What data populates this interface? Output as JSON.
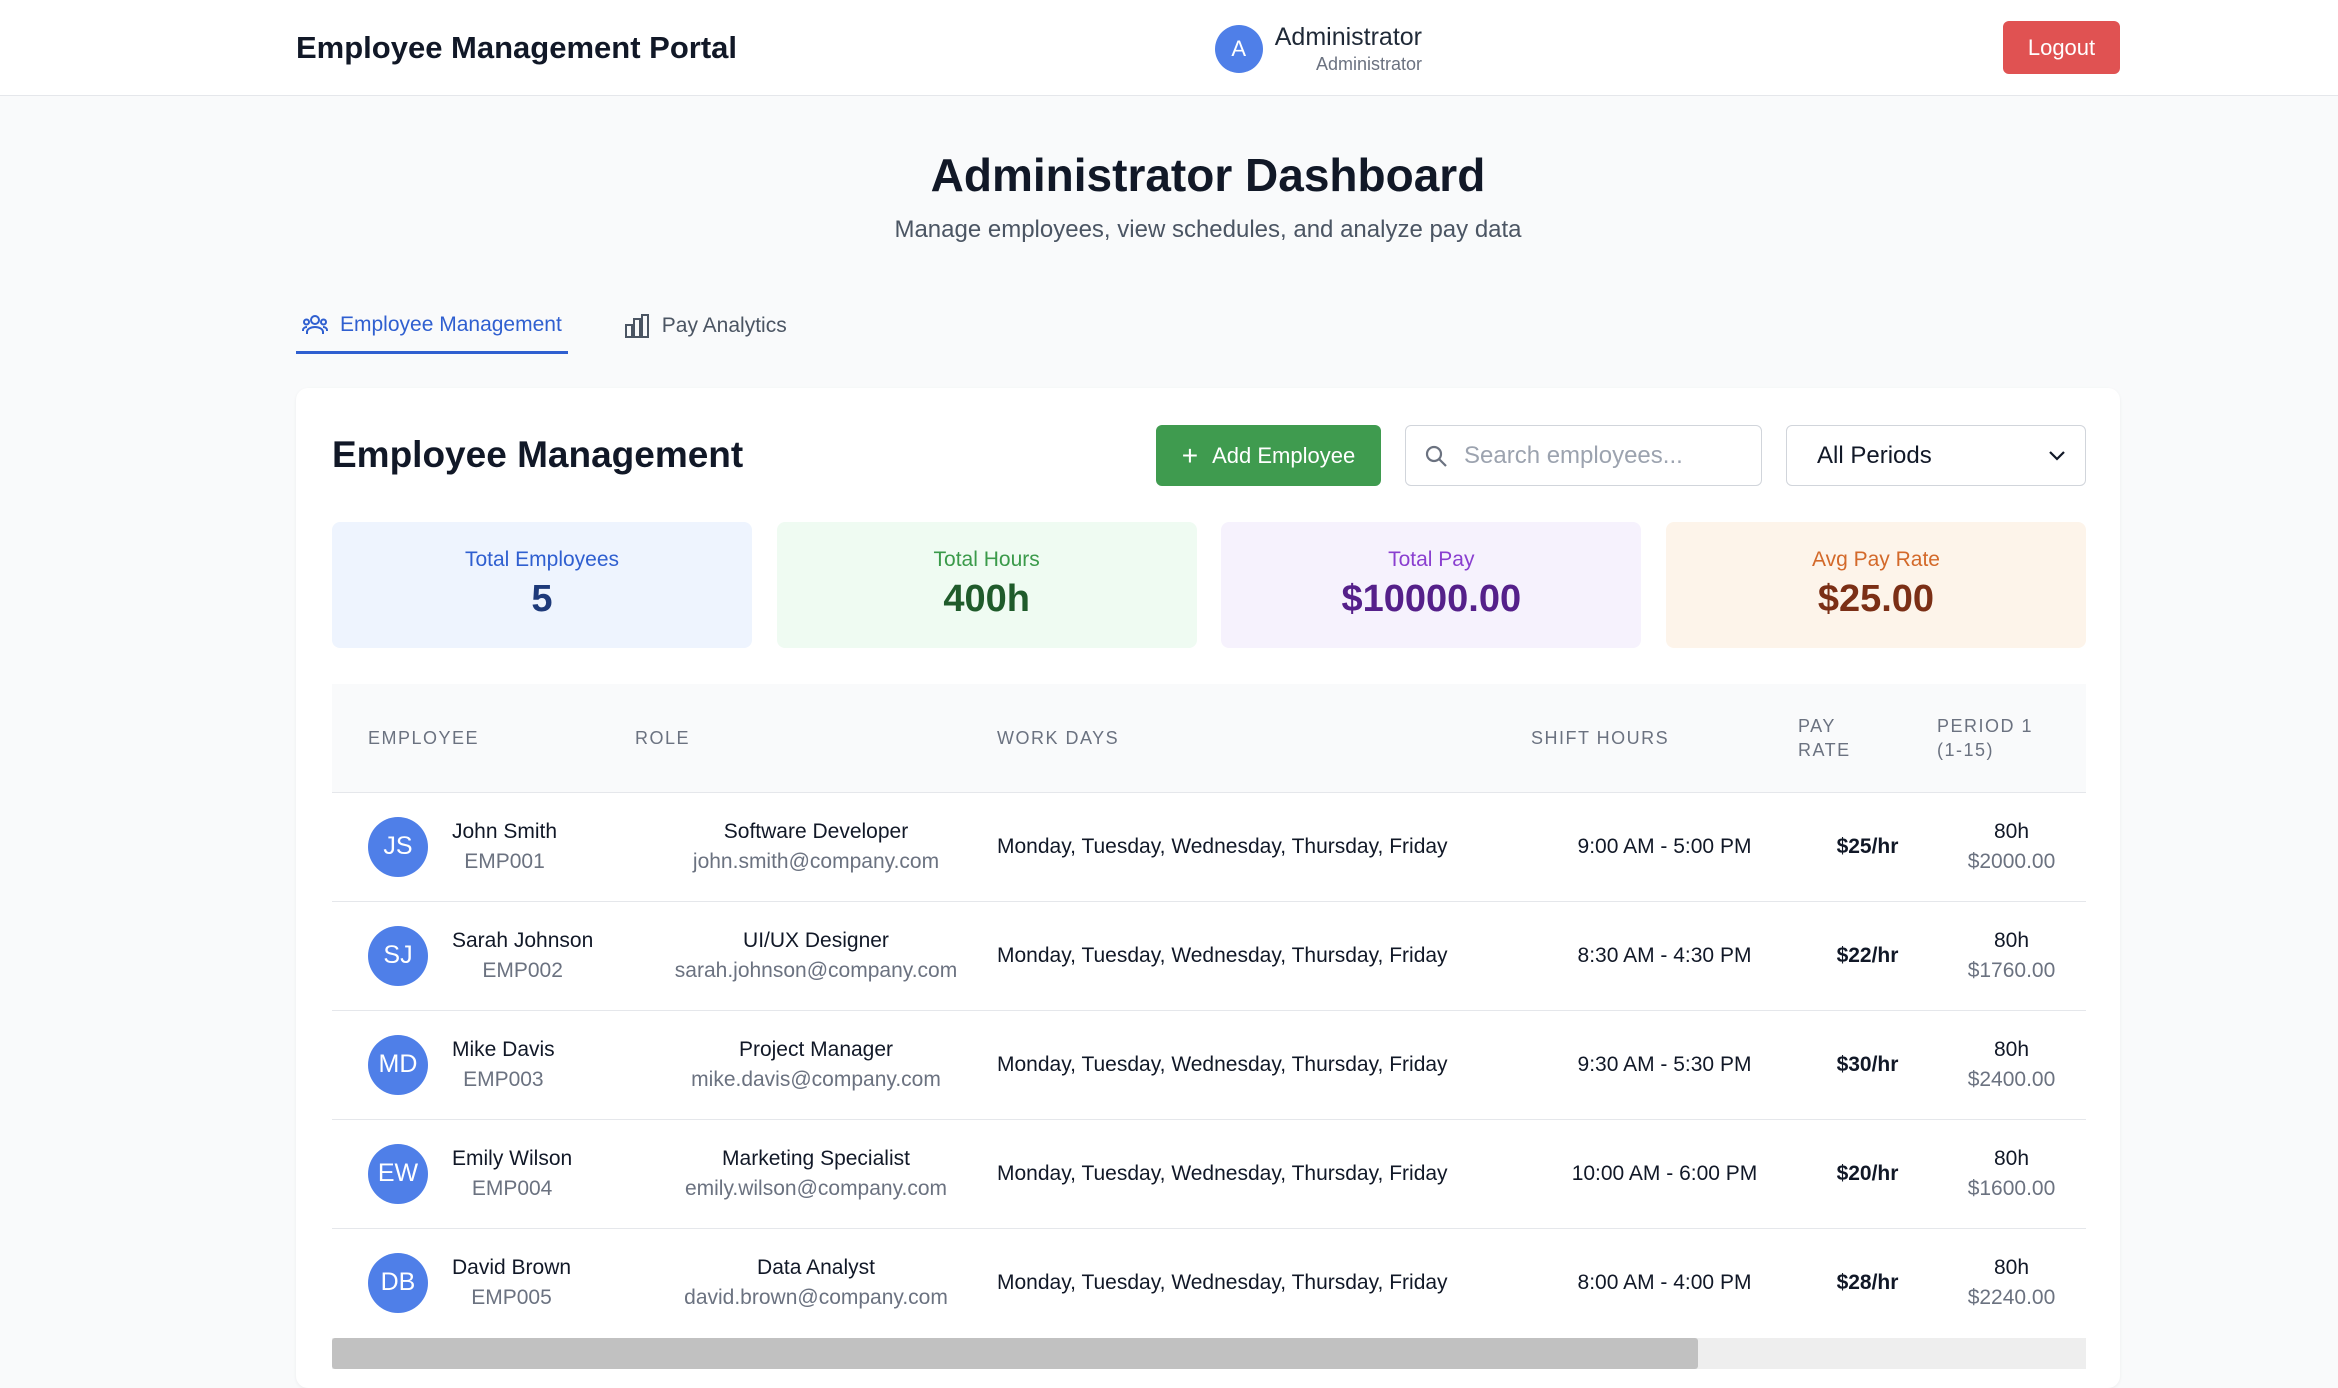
{
  "header": {
    "title": "Employee Management Portal",
    "user_initial": "A",
    "user_name": "Administrator",
    "user_role": "Administrator",
    "logout_label": "Logout"
  },
  "hero": {
    "title": "Administrator Dashboard",
    "subtitle": "Manage employees, view schedules, and analyze pay data"
  },
  "tabs": [
    {
      "label": "Employee Management",
      "icon": "users-icon",
      "active": true
    },
    {
      "label": "Pay Analytics",
      "icon": "bar-chart-icon",
      "active": false
    }
  ],
  "panel": {
    "title": "Employee Management",
    "add_label": "Add Employee",
    "search_placeholder": "Search employees...",
    "period_selected": "All Periods"
  },
  "stats": [
    {
      "label": "Total Employees",
      "value": "5"
    },
    {
      "label": "Total Hours",
      "value": "400h"
    },
    {
      "label": "Total Pay",
      "value": "$10000.00"
    },
    {
      "label": "Avg Pay Rate",
      "value": "$25.00"
    }
  ],
  "table": {
    "headers": {
      "employee": "Employee",
      "role": "Role",
      "work_days": "Work Days",
      "shift_hours": "Shift Hours",
      "pay_rate_1": "Pay",
      "pay_rate_2": "Rate",
      "period_1": "Period 1",
      "period_2": "(1-15)"
    },
    "rows": [
      {
        "initials": "JS",
        "name": "John Smith",
        "id": "EMP001",
        "role": "Software Developer",
        "email": "john.smith@company.com",
        "days": "Monday, Tuesday, Wednesday, Thursday, Friday",
        "shift": "9:00 AM - 5:00 PM",
        "rate": "$25/hr",
        "hours": "80h",
        "pay": "$2000.00"
      },
      {
        "initials": "SJ",
        "name": "Sarah Johnson",
        "id": "EMP002",
        "role": "UI/UX Designer",
        "email": "sarah.johnson@company.com",
        "days": "Monday, Tuesday, Wednesday, Thursday, Friday",
        "shift": "8:30 AM - 4:30 PM",
        "rate": "$22/hr",
        "hours": "80h",
        "pay": "$1760.00"
      },
      {
        "initials": "MD",
        "name": "Mike Davis",
        "id": "EMP003",
        "role": "Project Manager",
        "email": "mike.davis@company.com",
        "days": "Monday, Tuesday, Wednesday, Thursday, Friday",
        "shift": "9:30 AM - 5:30 PM",
        "rate": "$30/hr",
        "hours": "80h",
        "pay": "$2400.00"
      },
      {
        "initials": "EW",
        "name": "Emily Wilson",
        "id": "EMP004",
        "role": "Marketing Specialist",
        "email": "emily.wilson@company.com",
        "days": "Monday, Tuesday, Wednesday, Thursday, Friday",
        "shift": "10:00 AM - 6:00 PM",
        "rate": "$20/hr",
        "hours": "80h",
        "pay": "$1600.00"
      },
      {
        "initials": "DB",
        "name": "David Brown",
        "id": "EMP005",
        "role": "Data Analyst",
        "email": "david.brown@company.com",
        "days": "Monday, Tuesday, Wednesday, Thursday, Friday",
        "shift": "8:00 AM - 4:00 PM",
        "rate": "$28/hr",
        "hours": "80h",
        "pay": "$2240.00"
      }
    ]
  },
  "colors": {
    "brand_blue": "#2f5fd0",
    "avatar_blue": "#4f7fe8",
    "add_green": "#3f9b4f",
    "logout_red": "#e05252"
  }
}
